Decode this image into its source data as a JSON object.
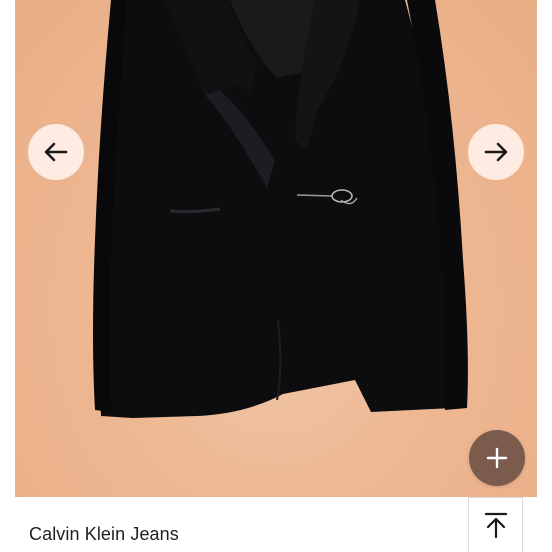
{
  "product": {
    "brand": "Calvin Klein Jeans",
    "image_icon": "black-blazer-photo"
  },
  "controls": {
    "prev_icon": "arrow-left-icon",
    "next_icon": "arrow-right-icon",
    "add_icon": "plus-icon",
    "scroll_top_icon": "arrow-up-to-top-icon"
  },
  "colors": {
    "background": "#ffffff",
    "image_backdrop": "#eeb893",
    "fab": "#7a5b4c",
    "nav_button": "#fff0e8",
    "text": "#1f1f1f"
  }
}
